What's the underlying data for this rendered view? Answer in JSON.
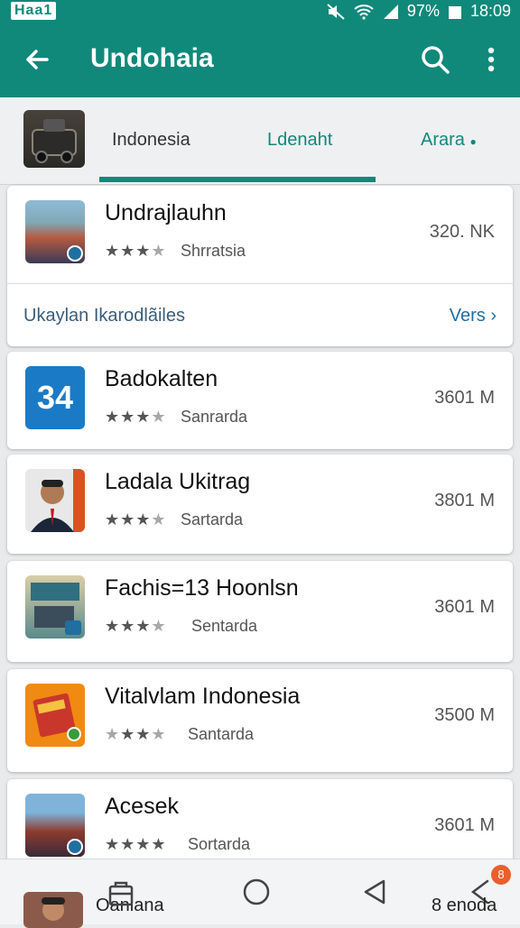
{
  "status": {
    "left": "Haa1",
    "battery": "97%",
    "time": "18:09"
  },
  "appbar": {
    "title": "Undohaia"
  },
  "tabs": [
    "Indonesia",
    "Ldenaht",
    "Arara"
  ],
  "featured": {
    "name": "Undrajlauhn",
    "subtitle": "Shrratsia",
    "size": "320. NK",
    "more_label": "Ukaylan Ikarodlãiles",
    "more_link": "Vers"
  },
  "apps": [
    {
      "name": "Badokalten",
      "subtitle": "Sanrarda",
      "size": "3601 M",
      "icon_text": "34"
    },
    {
      "name": "Ladala Ukitrag",
      "subtitle": "Sartarda",
      "size": "3801 M"
    },
    {
      "name": "Fachis=13 Hoonlsn",
      "subtitle": "Sentarda",
      "size": "3601 M"
    },
    {
      "name": "Vitalvlam Indonesia",
      "subtitle": "Santarda",
      "size": "3500 M"
    },
    {
      "name": "Acesek",
      "subtitle": "Sortarda",
      "size": "3601 M"
    }
  ],
  "bottom": {
    "left_label": "Oanlana",
    "right_label": "8 enoda",
    "notif": "8"
  },
  "colors": {
    "primary": "#10897a",
    "link": "#1f6fa0"
  }
}
